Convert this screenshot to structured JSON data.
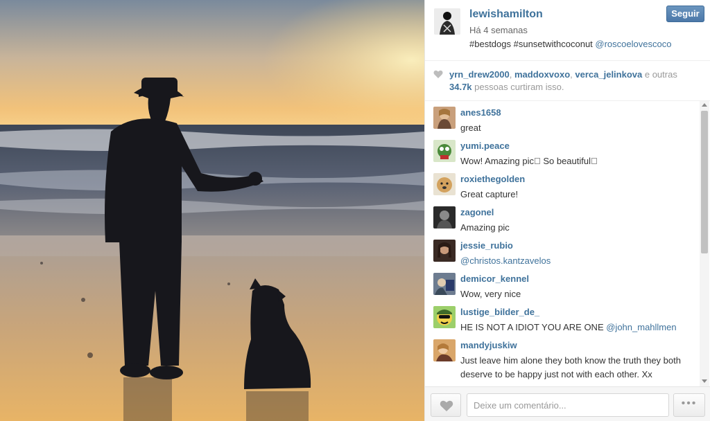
{
  "post": {
    "username": "lewishamilton",
    "time": "Há 4 semanas",
    "caption_text": "#bestdogs #sunsetwithcoconut ",
    "caption_mention": "@roscoelovescoco",
    "follow_label": "Seguir"
  },
  "likes": {
    "liker1": "yrn_drew2000",
    "sep1": ", ",
    "liker2": "maddoxvoxo",
    "sep2": ", ",
    "liker3": "verca_jelinkova",
    "and_others": " e outras",
    "count": "34.7k",
    "suffix": " pessoas curtiram isso."
  },
  "comments": [
    {
      "user": "anes1658",
      "text": "great",
      "mention": ""
    },
    {
      "user": "yumi.peace",
      "text": "Wow! Amazing pic􀀀 So beautiful􀀀",
      "mention": ""
    },
    {
      "user": "roxiethegolden",
      "text": "Great capture!",
      "mention": ""
    },
    {
      "user": "zagonel",
      "text": "Amazing pic",
      "mention": ""
    },
    {
      "user": "jessie_rubio",
      "text": "",
      "mention": "@christos.kantzavelos"
    },
    {
      "user": "demicor_kennel",
      "text": "Wow, very nice",
      "mention": ""
    },
    {
      "user": "lustige_bilder_de_",
      "text": "HE IS NOT A IDIOT YOU ARE ONE ",
      "mention": "@john_mahllmen"
    },
    {
      "user": "mandyjuskiw",
      "text": "Just leave him alone they both know the truth they both deserve to be happy just not with each other. Xx",
      "mention": ""
    }
  ],
  "footer": {
    "comment_placeholder": "Deixe um comentário...",
    "more_label": "•••"
  },
  "colors": {
    "link": "#3f729b",
    "follow_button": "#4b78a8"
  }
}
